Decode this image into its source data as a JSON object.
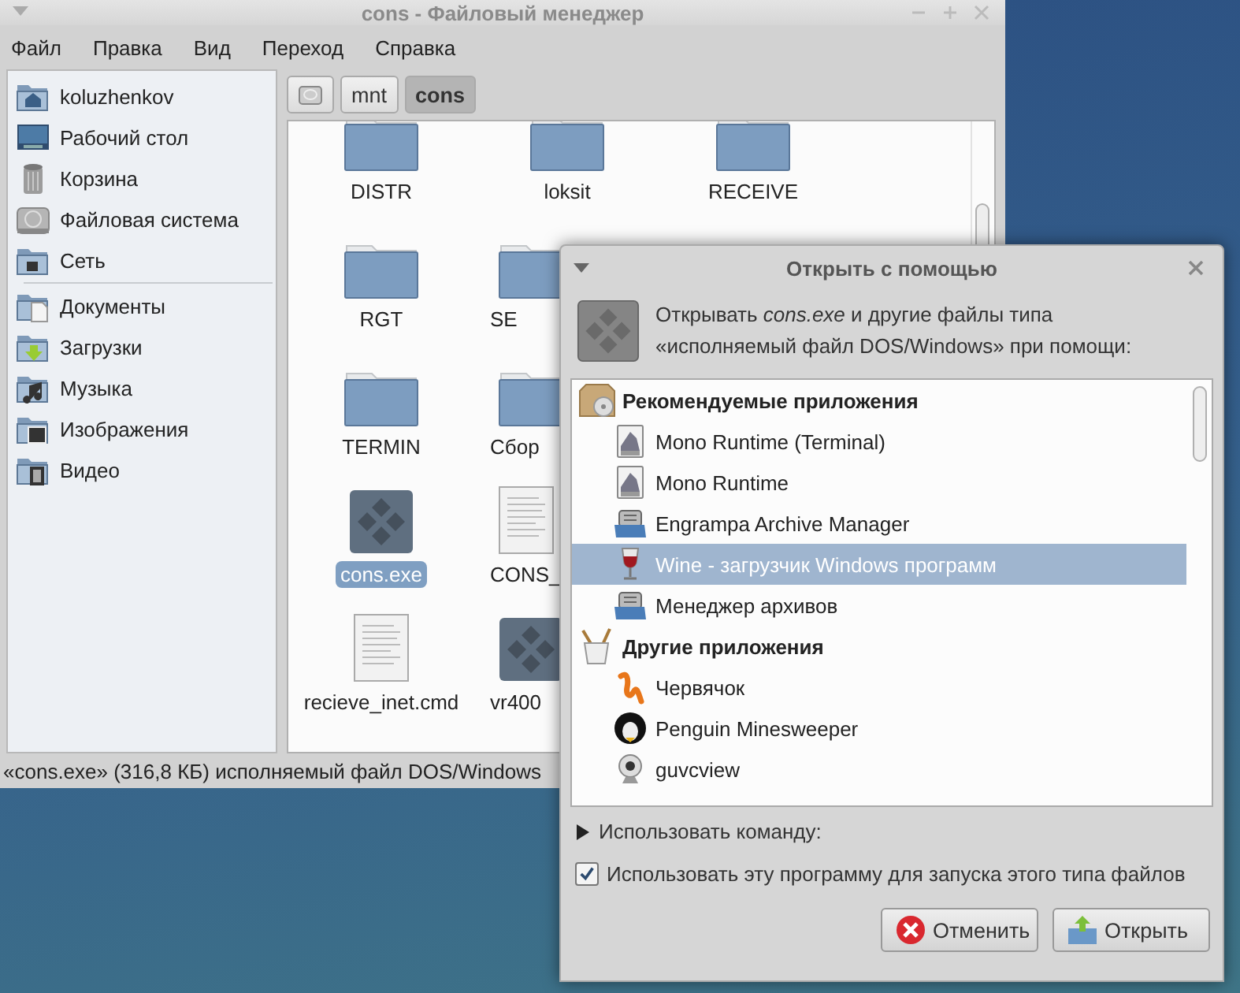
{
  "file_manager": {
    "title": "cons - Файловый менеджер",
    "menu": [
      "Файл",
      "Правка",
      "Вид",
      "Переход",
      "Справка"
    ],
    "sidebar": {
      "places": [
        {
          "label": "koluzhenkov",
          "kind": "home"
        },
        {
          "label": "Рабочий стол",
          "kind": "desktop"
        },
        {
          "label": "Корзина",
          "kind": "trash"
        },
        {
          "label": "Файловая система",
          "kind": "drive"
        },
        {
          "label": "Сеть",
          "kind": "network"
        }
      ],
      "bookmarks": [
        {
          "label": "Документы",
          "kind": "documents"
        },
        {
          "label": "Загрузки",
          "kind": "downloads"
        },
        {
          "label": "Музыка",
          "kind": "music"
        },
        {
          "label": "Изображения",
          "kind": "pictures"
        },
        {
          "label": "Видео",
          "kind": "video"
        }
      ]
    },
    "path": [
      {
        "kind": "drive",
        "selected": false
      },
      {
        "kind": "text",
        "label": "mnt",
        "selected": false
      },
      {
        "kind": "text",
        "label": "cons",
        "selected": true
      }
    ],
    "files": [
      {
        "name": "DISTR",
        "kind": "folder",
        "selected": false
      },
      {
        "name": "loksit",
        "kind": "folder",
        "selected": false
      },
      {
        "name": "RECEIVE",
        "kind": "folder",
        "selected": false
      },
      {
        "name": "RGT",
        "kind": "folder",
        "selected": false
      },
      {
        "name": "SE",
        "kind": "folder",
        "selected": false
      },
      {
        "name": "TERMIN",
        "kind": "folder",
        "selected": false
      },
      {
        "name": "Сбор",
        "kind": "folder",
        "selected": false
      },
      {
        "name": "cons.exe",
        "kind": "exe",
        "selected": true
      },
      {
        "name": "CONS_",
        "kind": "text",
        "selected": false
      },
      {
        "name": "recieve_inet.cmd",
        "kind": "text",
        "selected": false
      },
      {
        "name": "vr400",
        "kind": "exe",
        "selected": false
      }
    ],
    "status_bar": "«cons.exe» (316,8 КБ) исполняемый файл DOS/Windows"
  },
  "dialog": {
    "title": "Открыть с помощью",
    "description": "Открывать *cons.exe* и другие файлы типа «исполняемый файл DOS/Windows» при помощи:",
    "groups": [
      {
        "label": "Рекомендуемые приложения",
        "kind": "package",
        "children": [
          {
            "label": "Mono Runtime (Terminal)",
            "kind": "mono",
            "selected": false
          },
          {
            "label": "Mono Runtime",
            "kind": "mono",
            "selected": false
          },
          {
            "label": "Engrampa Archive Manager",
            "kind": "archive",
            "selected": false
          },
          {
            "label": "Wine - загрузчик Windows программ",
            "kind": "wine",
            "selected": true
          },
          {
            "label": "Менеджер архивов",
            "kind": "archive",
            "selected": false
          }
        ]
      },
      {
        "label": "Другие приложения",
        "kind": "cup",
        "children": [
          {
            "label": "Червячок",
            "kind": "worm",
            "selected": false
          },
          {
            "label": "Penguin Minesweeper",
            "kind": "penguin",
            "selected": false
          },
          {
            "label": "guvcview",
            "kind": "webcam",
            "selected": false
          }
        ]
      }
    ],
    "command": {
      "label": "Использовать команду:",
      "expanded": false
    },
    "remember": {
      "label": "Использовать эту программу для запуска этого типа файлов",
      "checked": true
    },
    "buttons": [
      {
        "label": "Отменить",
        "kind": "cancel"
      },
      {
        "label": "Открыть",
        "kind": "open"
      }
    ]
  }
}
